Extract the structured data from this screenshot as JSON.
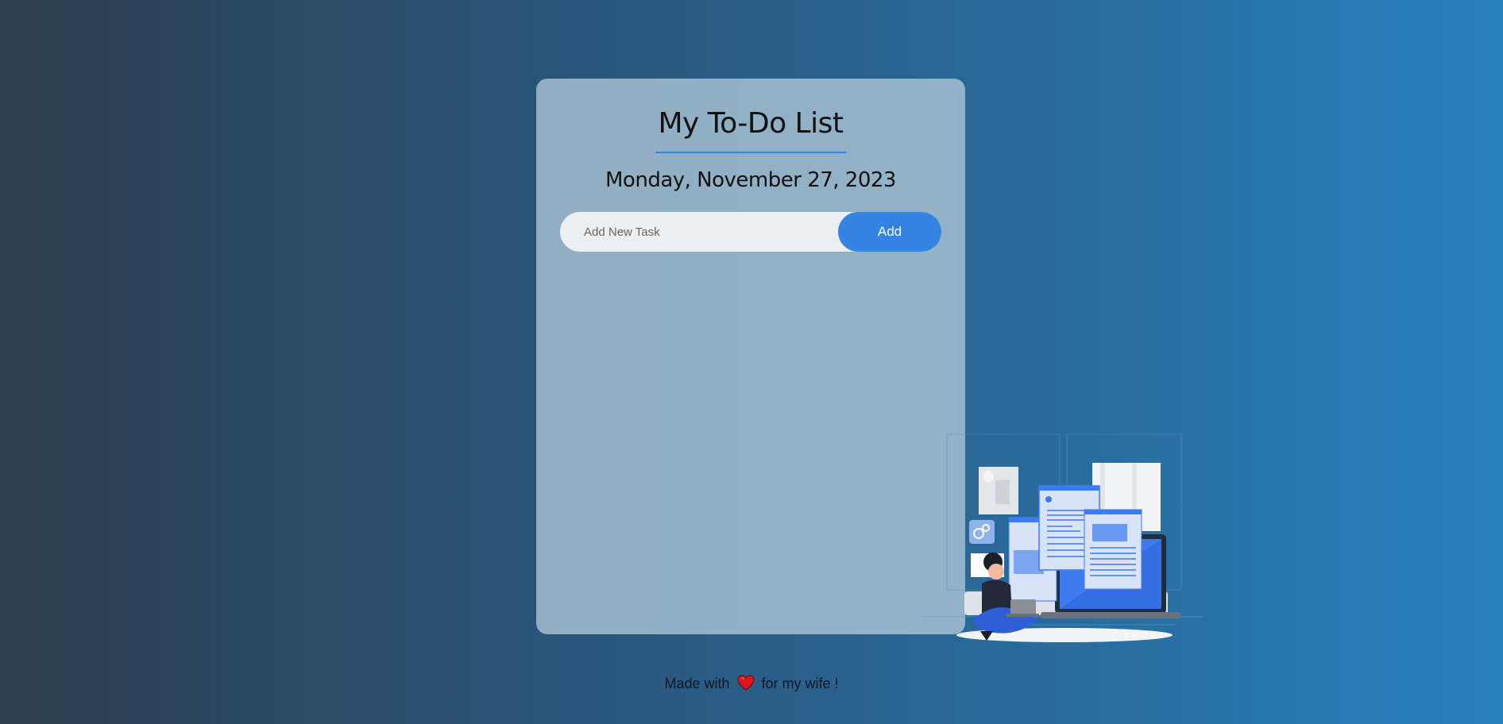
{
  "app": {
    "title": "My To-Do List",
    "date": "Monday, November 27, 2023"
  },
  "task_form": {
    "input_value": "",
    "input_placeholder": "Add New Task",
    "add_label": "Add"
  },
  "tasks": [],
  "footer": {
    "prefix": "Made with",
    "icon": "heart-icon",
    "suffix": "for my wife !"
  },
  "colors": {
    "accent": "#3584e4",
    "heart": "#e0151b"
  }
}
